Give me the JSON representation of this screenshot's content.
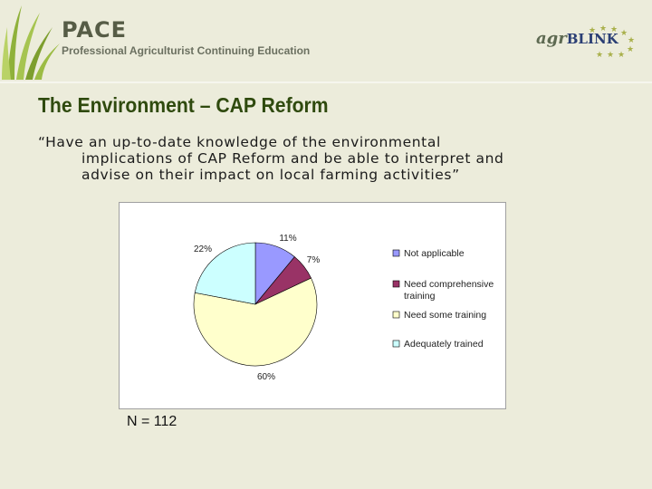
{
  "header": {
    "brand_name": "PACE",
    "brand_tagline": "Professional Agriculturist Continuing Education",
    "partner_logo_a": "agr",
    "partner_logo_b": "BLINK"
  },
  "slide": {
    "title": "The Environment – CAP Reform",
    "quote_line1": "“Have an up-to-date knowledge of the environmental",
    "quote_line2": "implications of CAP Reform and be able to interpret and",
    "quote_line3": "advise on their impact on local farming activities”",
    "sample_size": "N = 112"
  },
  "colors": {
    "background": "#ececdb",
    "title": "#2f4a0e",
    "brand": "#565c46"
  },
  "chart_data": {
    "type": "pie",
    "title": "",
    "slices": [
      {
        "name": "Not applicable",
        "value": 11,
        "label": "11%",
        "color": "#9999ff"
      },
      {
        "name": "Need comprehensive training",
        "value": 7,
        "label": "7%",
        "color": "#993366"
      },
      {
        "name": "Need some training",
        "value": 60,
        "label": "60%",
        "color": "#ffffcc"
      },
      {
        "name": "Adequately trained",
        "value": 22,
        "label": "22%",
        "color": "#ccffff"
      }
    ],
    "legend_position": "right",
    "legend_entries": [
      "Not applicable",
      "Need comprehensive training",
      "Need some training",
      "Adequately trained"
    ]
  }
}
